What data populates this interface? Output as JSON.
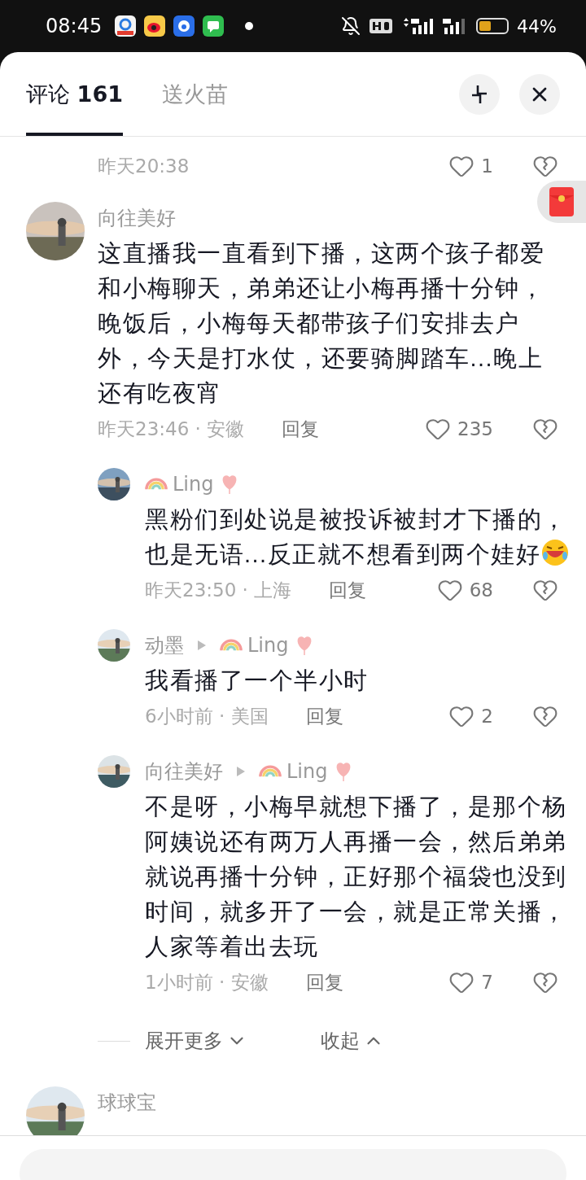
{
  "status_bar": {
    "time": "08:45",
    "battery_text": "44%"
  },
  "tabs": [
    {
      "label": "评论 **161**",
      "selected": true
    },
    {
      "label": "送火苗",
      "selected": false
    }
  ],
  "comments": [
    {
      "kind": "partial_meta",
      "meta": "昨天20:38",
      "likes": "1"
    },
    {
      "kind": "comment",
      "author": {
        "name": "向往美好",
        "decorated": false
      },
      "text": "这直播我一直看到下播，这两个孩子都爱和小梅聊天，弟弟还让小梅再播十分钟，晚饭后，小梅每天都带孩子们安排去户外，今天是打水仗，还要骑脚踏车...晚上还有吃夜宵",
      "trailing_emoji": false,
      "meta": "昨天23:46 · 安徽",
      "reply": "回复",
      "likes": "235",
      "replies": [
        {
          "author": {
            "name": "Ling",
            "decorated": true
          },
          "text": "黑粉们到处说是被投诉被封才下播的，也是无语...反正就不想看到两个娃好",
          "trailing_emoji": true,
          "meta": "昨天23:50 · 上海",
          "reply": "回复",
          "likes": "68"
        },
        {
          "author": {
            "name": "动墨",
            "decorated": false
          },
          "reply_to": {
            "name": "Ling",
            "decorated": true
          },
          "text": "我看播了一个半小时",
          "trailing_emoji": false,
          "meta": "6小时前 · 美国",
          "reply": "回复",
          "likes": "2"
        },
        {
          "author": {
            "name": "向往美好",
            "decorated": false
          },
          "reply_to": {
            "name": "Ling",
            "decorated": true
          },
          "text": "不是呀，小梅早就想下播了，是那个杨阿姨说还有两万人再播一会，然后弟弟就说再播十分钟，正好那个福袋也没到时间，就多开了一会，就是正常关播，人家等着出去玩",
          "trailing_emoji": false,
          "meta": "1小时前 · 安徽",
          "reply": "回复",
          "likes": "7"
        }
      ],
      "expand": "展开更多",
      "collapse": "收起"
    },
    {
      "kind": "name_only",
      "author": {
        "name": "球球宝",
        "decorated": false
      }
    }
  ]
}
